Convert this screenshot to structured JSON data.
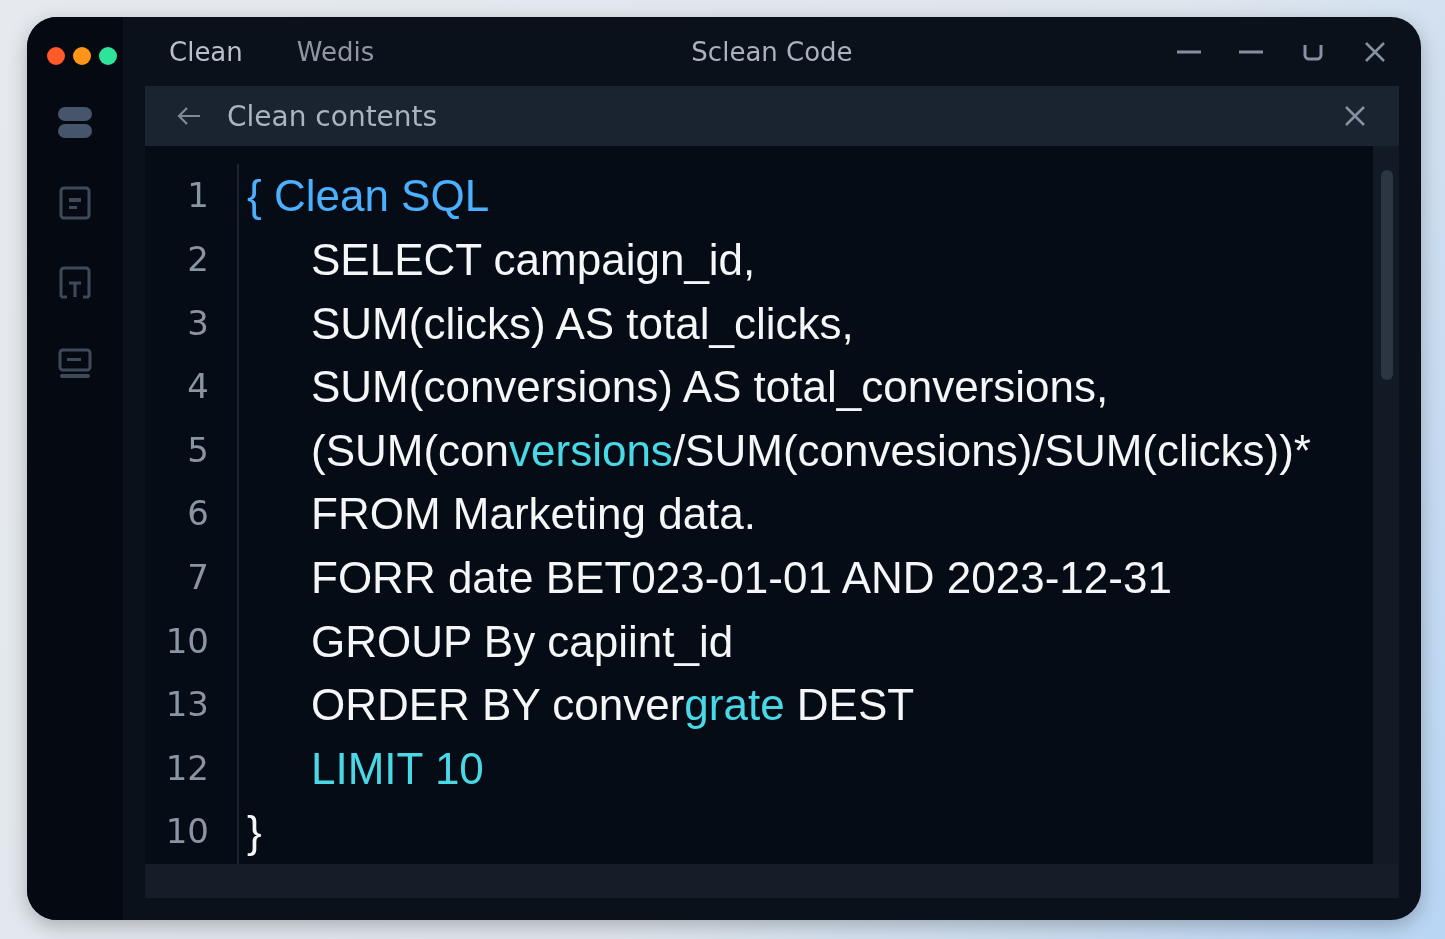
{
  "window": {
    "title": "Sclean Code",
    "tabs": [
      {
        "label": "Clean",
        "selected": true
      },
      {
        "label": "Wedis",
        "selected": false
      }
    ]
  },
  "panel": {
    "title": "Clean contents"
  },
  "editor": {
    "lines": [
      {
        "number": "1",
        "segments": [
          {
            "text": "{",
            "kind": "heading"
          },
          {
            "text": " Clean SQL",
            "kind": "heading"
          }
        ],
        "children": [
          {
            "number": "2",
            "segments": [
              {
                "text": "SELECT campaign_id,",
                "kind": "plain"
              }
            ]
          },
          {
            "number": "3",
            "segments": [
              {
                "text": "SUM(clicks) AS total_clicks,",
                "kind": "plain"
              }
            ]
          },
          {
            "number": "4",
            "segments": [
              {
                "text": "SUM(conversions) AS total_conversions,",
                "kind": "plain"
              }
            ]
          },
          {
            "number": "5",
            "segments": [
              {
                "text": "(SUM(con",
                "kind": "plain"
              },
              {
                "text": "versions",
                "kind": "accent"
              },
              {
                "text": "/SUM(convesions)/SUM(clicks))*",
                "kind": "plain"
              }
            ]
          },
          {
            "number": "6",
            "segments": [
              {
                "text": "FROM Marketing data.",
                "kind": "plain"
              }
            ]
          },
          {
            "number": "7",
            "segments": [
              {
                "text": "FORR date BET023-01-01 AND 2023-12-31",
                "kind": "plain"
              }
            ]
          },
          {
            "number": "10",
            "segments": [
              {
                "text": "GROUP By capiint_id",
                "kind": "plain"
              }
            ]
          },
          {
            "number": "13",
            "segments": [
              {
                "text": "ORDER BY conver",
                "kind": "plain"
              },
              {
                "text": "grate",
                "kind": "accent"
              },
              {
                "text": " DEST",
                "kind": "plain"
              }
            ]
          },
          {
            "number": "12",
            "segments": [
              {
                "text": "LIMIT 10",
                "kind": "accent"
              }
            ]
          }
        ]
      },
      {
        "number": "10",
        "segments": [
          {
            "text": "}",
            "kind": "plain"
          }
        ]
      }
    ]
  }
}
